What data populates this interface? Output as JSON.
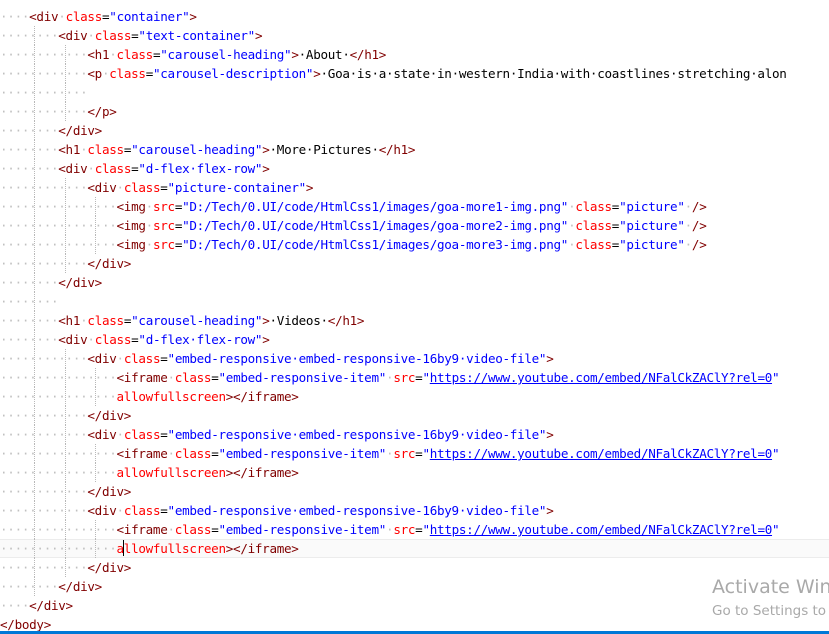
{
  "colors": {
    "tag": "#800000",
    "attribute": "#ff0000",
    "value": "#0000ff",
    "text": "#000000",
    "whitespace_marker": "#c0c0c0",
    "status_bar": "#0078d7"
  },
  "code_lines": [
    {
      "ws": "····",
      "tokens": [
        [
          "t",
          "<div"
        ],
        [
          "ws",
          "·"
        ],
        [
          "a",
          "class"
        ],
        [
          "p",
          "="
        ],
        [
          "v",
          "\"container\""
        ],
        [
          "t",
          ">"
        ]
      ]
    },
    {
      "ws": "····|···",
      "tokens": [
        [
          "t",
          "<div"
        ],
        [
          "ws",
          "·"
        ],
        [
          "a",
          "class"
        ],
        [
          "p",
          "="
        ],
        [
          "v",
          "\"text-container\""
        ],
        [
          "t",
          ">"
        ]
      ]
    },
    {
      "ws": "····|···|···",
      "tokens": [
        [
          "t",
          "<h1"
        ],
        [
          "ws",
          "·"
        ],
        [
          "a",
          "class"
        ],
        [
          "p",
          "="
        ],
        [
          "v",
          "\"carousel-heading\""
        ],
        [
          "t",
          ">"
        ],
        [
          "p",
          "·About·"
        ],
        [
          "t",
          "</h1>"
        ]
      ]
    },
    {
      "ws": "····|···|···",
      "tokens": [
        [
          "t",
          "<p"
        ],
        [
          "ws",
          "·"
        ],
        [
          "a",
          "class"
        ],
        [
          "p",
          "="
        ],
        [
          "v",
          "\"carousel-description\""
        ],
        [
          "t",
          ">"
        ],
        [
          "p",
          "·Goa·is·a·state·in·western·India·with·coastlines·stretching·alon"
        ]
      ]
    },
    {
      "ws": "····|···|···",
      "tokens": []
    },
    {
      "ws": "····|···|···",
      "tokens": [
        [
          "t",
          "</p>"
        ]
      ]
    },
    {
      "ws": "····|···",
      "tokens": [
        [
          "t",
          "</div>"
        ]
      ]
    },
    {
      "ws": "····|···",
      "tokens": [
        [
          "t",
          "<h1"
        ],
        [
          "ws",
          "·"
        ],
        [
          "a",
          "class"
        ],
        [
          "p",
          "="
        ],
        [
          "v",
          "\"carousel-heading\""
        ],
        [
          "t",
          ">"
        ],
        [
          "p",
          "·More·Pictures·"
        ],
        [
          "t",
          "</h1>"
        ]
      ]
    },
    {
      "ws": "····|···",
      "tokens": [
        [
          "t",
          "<div"
        ],
        [
          "ws",
          "·"
        ],
        [
          "a",
          "class"
        ],
        [
          "p",
          "="
        ],
        [
          "v",
          "\"d-flex·flex-row\""
        ],
        [
          "t",
          ">"
        ]
      ]
    },
    {
      "ws": "····|···|···",
      "tokens": [
        [
          "t",
          "<div"
        ],
        [
          "ws",
          "·"
        ],
        [
          "a",
          "class"
        ],
        [
          "p",
          "="
        ],
        [
          "v",
          "\"picture-container\""
        ],
        [
          "t",
          ">"
        ]
      ]
    },
    {
      "ws": "····|···|···|···",
      "tokens": [
        [
          "t",
          "<img"
        ],
        [
          "ws",
          "·"
        ],
        [
          "a",
          "src"
        ],
        [
          "p",
          "="
        ],
        [
          "v",
          "\"D:/Tech/0.UI/code/HtmlCss1/images/goa-more1-img.png\""
        ],
        [
          "ws",
          "·"
        ],
        [
          "a",
          "class"
        ],
        [
          "p",
          "="
        ],
        [
          "v",
          "\"picture\""
        ],
        [
          "ws",
          "·"
        ],
        [
          "t",
          "/>"
        ]
      ]
    },
    {
      "ws": "····|···|···|···",
      "tokens": [
        [
          "t",
          "<img"
        ],
        [
          "ws",
          "·"
        ],
        [
          "a",
          "src"
        ],
        [
          "p",
          "="
        ],
        [
          "v",
          "\"D:/Tech/0.UI/code/HtmlCss1/images/goa-more2-img.png\""
        ],
        [
          "ws",
          "·"
        ],
        [
          "a",
          "class"
        ],
        [
          "p",
          "="
        ],
        [
          "v",
          "\"picture\""
        ],
        [
          "ws",
          "·"
        ],
        [
          "t",
          "/>"
        ]
      ]
    },
    {
      "ws": "····|···|···|···",
      "tokens": [
        [
          "t",
          "<img"
        ],
        [
          "ws",
          "·"
        ],
        [
          "a",
          "src"
        ],
        [
          "p",
          "="
        ],
        [
          "v",
          "\"D:/Tech/0.UI/code/HtmlCss1/images/goa-more3-img.png\""
        ],
        [
          "ws",
          "·"
        ],
        [
          "a",
          "class"
        ],
        [
          "p",
          "="
        ],
        [
          "v",
          "\"picture\""
        ],
        [
          "ws",
          "·"
        ],
        [
          "t",
          "/>"
        ]
      ]
    },
    {
      "ws": "····|···|···",
      "tokens": [
        [
          "t",
          "</div>"
        ]
      ]
    },
    {
      "ws": "····|···",
      "tokens": [
        [
          "t",
          "</div>"
        ]
      ]
    },
    {
      "ws": "····|···",
      "tokens": []
    },
    {
      "ws": "····|···",
      "tokens": [
        [
          "t",
          "<h1"
        ],
        [
          "ws",
          "·"
        ],
        [
          "a",
          "class"
        ],
        [
          "p",
          "="
        ],
        [
          "v",
          "\"carousel-heading\""
        ],
        [
          "t",
          ">"
        ],
        [
          "p",
          "·Videos·"
        ],
        [
          "t",
          "</h1>"
        ]
      ]
    },
    {
      "ws": "····|···",
      "tokens": [
        [
          "t",
          "<div"
        ],
        [
          "ws",
          "·"
        ],
        [
          "a",
          "class"
        ],
        [
          "p",
          "="
        ],
        [
          "v",
          "\"d-flex·flex-row\""
        ],
        [
          "t",
          ">"
        ]
      ]
    },
    {
      "ws": "····|···|···",
      "tokens": [
        [
          "t",
          "<div"
        ],
        [
          "ws",
          "·"
        ],
        [
          "a",
          "class"
        ],
        [
          "p",
          "="
        ],
        [
          "v",
          "\"embed-responsive·embed-responsive-16by9·video-file\""
        ],
        [
          "t",
          ">"
        ]
      ]
    },
    {
      "ws": "····|···|···|···",
      "tokens": [
        [
          "t",
          "<iframe"
        ],
        [
          "ws",
          "·"
        ],
        [
          "a",
          "class"
        ],
        [
          "p",
          "="
        ],
        [
          "v",
          "\"embed-responsive-item\""
        ],
        [
          "ws",
          "·"
        ],
        [
          "a",
          "src"
        ],
        [
          "p",
          "="
        ],
        [
          "v",
          "\""
        ],
        [
          "lnk",
          "https://www.youtube.com/embed/NFalCkZAClY?rel=0"
        ],
        [
          "v",
          "\""
        ]
      ]
    },
    {
      "ws": "····|···|···|···",
      "tokens": [
        [
          "a",
          "allowfullscreen"
        ],
        [
          "t",
          "></iframe>"
        ]
      ]
    },
    {
      "ws": "····|···|···",
      "tokens": [
        [
          "t",
          "</div>"
        ]
      ]
    },
    {
      "ws": "····|···|···",
      "tokens": [
        [
          "t",
          "<div"
        ],
        [
          "ws",
          "·"
        ],
        [
          "a",
          "class"
        ],
        [
          "p",
          "="
        ],
        [
          "v",
          "\"embed-responsive·embed-responsive-16by9·video-file\""
        ],
        [
          "t",
          ">"
        ]
      ]
    },
    {
      "ws": "····|···|···|···",
      "tokens": [
        [
          "t",
          "<iframe"
        ],
        [
          "ws",
          "·"
        ],
        [
          "a",
          "class"
        ],
        [
          "p",
          "="
        ],
        [
          "v",
          "\"embed-responsive-item\""
        ],
        [
          "ws",
          "·"
        ],
        [
          "a",
          "src"
        ],
        [
          "p",
          "="
        ],
        [
          "v",
          "\""
        ],
        [
          "lnk",
          "https://www.youtube.com/embed/NFalCkZAClY?rel=0"
        ],
        [
          "v",
          "\""
        ]
      ]
    },
    {
      "ws": "····|···|···|···",
      "tokens": [
        [
          "a",
          "allowfullscreen"
        ],
        [
          "t",
          "></iframe>"
        ]
      ]
    },
    {
      "ws": "····|···|···",
      "tokens": [
        [
          "t",
          "</div>"
        ]
      ]
    },
    {
      "ws": "····|···|···",
      "tokens": [
        [
          "t",
          "<div"
        ],
        [
          "ws",
          "·"
        ],
        [
          "a",
          "class"
        ],
        [
          "p",
          "="
        ],
        [
          "v",
          "\"embed-responsive·embed-responsive-16by9·video-file\""
        ],
        [
          "t",
          ">"
        ]
      ]
    },
    {
      "ws": "····|···|···|···",
      "tokens": [
        [
          "t",
          "<iframe"
        ],
        [
          "ws",
          "·"
        ],
        [
          "a",
          "class"
        ],
        [
          "p",
          "="
        ],
        [
          "v",
          "\"embed-responsive-item\""
        ],
        [
          "ws",
          "·"
        ],
        [
          "a",
          "src"
        ],
        [
          "p",
          "="
        ],
        [
          "v",
          "\""
        ],
        [
          "lnk",
          "https://www.youtube.com/embed/NFalCkZAClY?rel=0"
        ],
        [
          "v",
          "\""
        ]
      ]
    },
    {
      "ws": "····|···|···|···",
      "tokens": [
        [
          "a",
          "allowfullscreen"
        ],
        [
          "t",
          "></iframe>"
        ]
      ],
      "caret": true
    },
    {
      "ws": "····|···|···",
      "tokens": [
        [
          "t",
          "</div>"
        ]
      ]
    },
    {
      "ws": "····|···",
      "tokens": [
        [
          "t",
          "</div>"
        ]
      ]
    },
    {
      "ws": "····",
      "tokens": [
        [
          "t",
          "</div>"
        ]
      ]
    },
    {
      "ws": "",
      "tokens": [
        [
          "t",
          "</body>"
        ]
      ]
    }
  ],
  "activation": {
    "title": "Activate Wind",
    "subtitle": "Go to Settings to"
  }
}
